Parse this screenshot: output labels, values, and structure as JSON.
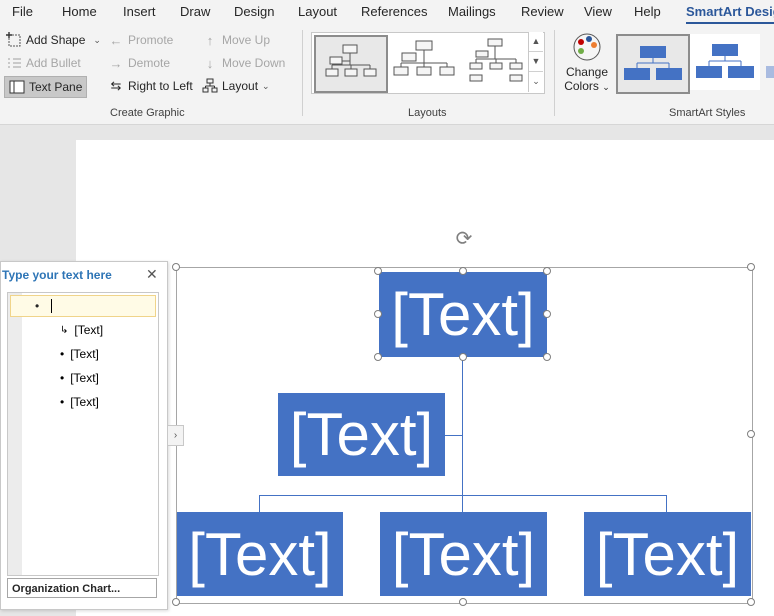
{
  "menu": {
    "tabs": [
      "File",
      "Home",
      "Insert",
      "Draw",
      "Design",
      "Layout",
      "References",
      "Mailings",
      "Review",
      "View",
      "Help",
      "SmartArt Design"
    ],
    "active_tab": "SmartArt Design"
  },
  "ribbon": {
    "create_graphic": {
      "label": "Create Graphic",
      "add_shape": "Add Shape",
      "add_bullet": "Add Bullet",
      "text_pane": "Text Pane",
      "promote": "Promote",
      "demote": "Demote",
      "right_to_left": "Right to Left",
      "move_up": "Move Up",
      "move_down": "Move Down",
      "layout": "Layout"
    },
    "layouts": {
      "label": "Layouts"
    },
    "smartart_styles": {
      "label": "SmartArt Styles",
      "change_colors_line1": "Change",
      "change_colors_line2": "Colors"
    }
  },
  "text_pane": {
    "title": "Type your text here",
    "items": [
      {
        "level": 2,
        "text": "[Text]",
        "bullet": "↳"
      },
      {
        "level": 2,
        "text": "[Text]",
        "bullet": "•"
      },
      {
        "level": 2,
        "text": "[Text]",
        "bullet": "•"
      },
      {
        "level": 2,
        "text": "[Text]",
        "bullet": "•"
      }
    ],
    "first_bullet": "•",
    "footer": "Organization Chart..."
  },
  "diagram": {
    "top": "[Text]",
    "assistant": "[Text]",
    "children": [
      "[Text]",
      "[Text]",
      "[Text]"
    ],
    "node_color": "#4472c4"
  },
  "colors": {
    "accent": "#2b579a",
    "smartart_blue": "#4472c4",
    "pane_title": "#2e75b6"
  },
  "icons": [
    "add-shape-icon",
    "add-bullet-icon",
    "text-pane-icon",
    "promote-icon",
    "demote-icon",
    "right-to-left-icon",
    "move-up-icon",
    "move-down-icon",
    "layout-icon",
    "change-colors-icon",
    "close-icon",
    "rotate-icon"
  ]
}
